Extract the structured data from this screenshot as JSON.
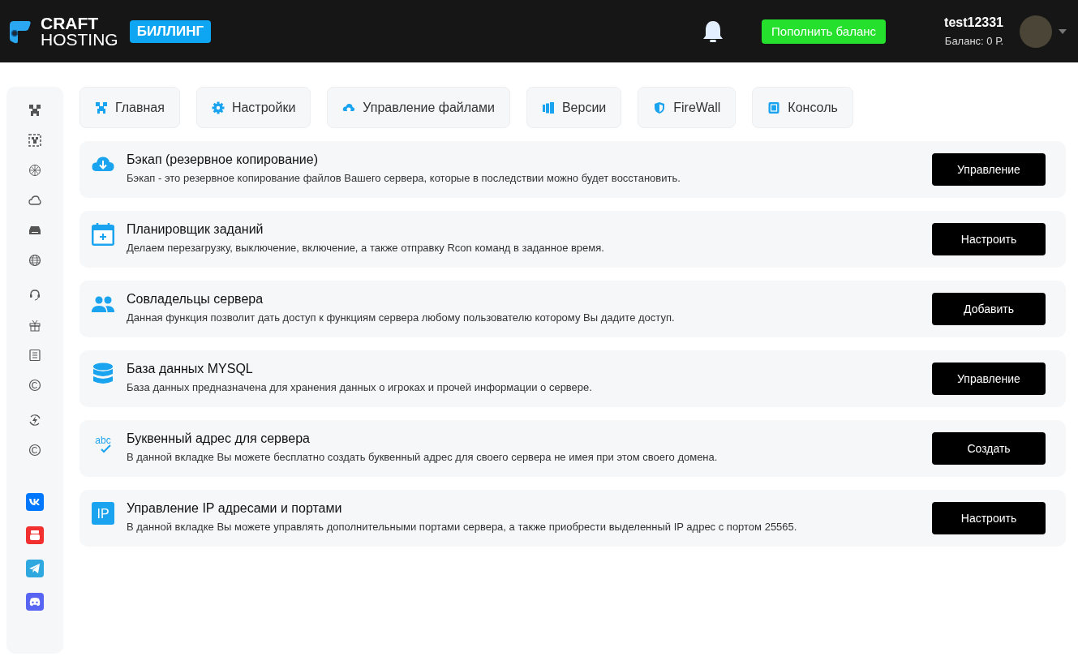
{
  "header": {
    "logo_top": "CRAFT",
    "logo_bottom": "HOSTING",
    "badge": "БИЛЛИНГ",
    "topup_button": "Пополнить баланс",
    "username": "test12331",
    "balance": "Баланс: 0 Р."
  },
  "tabs": [
    {
      "label": "Главная",
      "kind": "home",
      "selected": false
    },
    {
      "label": "Настройки",
      "kind": "settings",
      "selected": false
    },
    {
      "label": "Управление файлами",
      "kind": "files",
      "selected": false
    },
    {
      "label": "Версии",
      "kind": "versions",
      "selected": false
    },
    {
      "label": "FireWall",
      "kind": "firewall",
      "selected": false
    },
    {
      "label": "Консоль",
      "kind": "console",
      "selected": false
    }
  ],
  "features": [
    {
      "kind": "backup",
      "title": "Бэкап (резервное копирование)",
      "description": "Бэкап - это резервное копирование файлов Вашего сервера, которые в последствии можно будет восстановить.",
      "button": "Управление"
    },
    {
      "kind": "scheduler",
      "title": "Планировщик заданий",
      "description": "Делаем перезагрузку, выключение, включение, а также отправку Rcon команд в заданное время.",
      "button": "Настроить"
    },
    {
      "kind": "users",
      "title": "Совладельцы сервера",
      "description": "Данная функция позволит дать доступ к функциям сервера любому пользователю которому Вы дадите доступ.",
      "button": "Добавить"
    },
    {
      "kind": "database",
      "title": "База данных MYSQL",
      "description": "База данных предназначена для хранения данных о игроках и прочей информации о сервере.",
      "button": "Управление"
    },
    {
      "kind": "domain",
      "icon_label": "abc",
      "title": "Буквенный адрес для сервера",
      "description": "В данной вкладке Вы можете бесплатно создать буквенный адрес для своего сервера не имея при этом своего домена.",
      "button": "Создать"
    },
    {
      "kind": "ip",
      "icon_label": "IP",
      "title": "Управление IP адресами и портами",
      "description": "В данной вкладке Вы можете управлять дополнительными портами сервера, а также приобрести выделенный IP адрес с портом 25565.",
      "button": "Настроить"
    }
  ]
}
